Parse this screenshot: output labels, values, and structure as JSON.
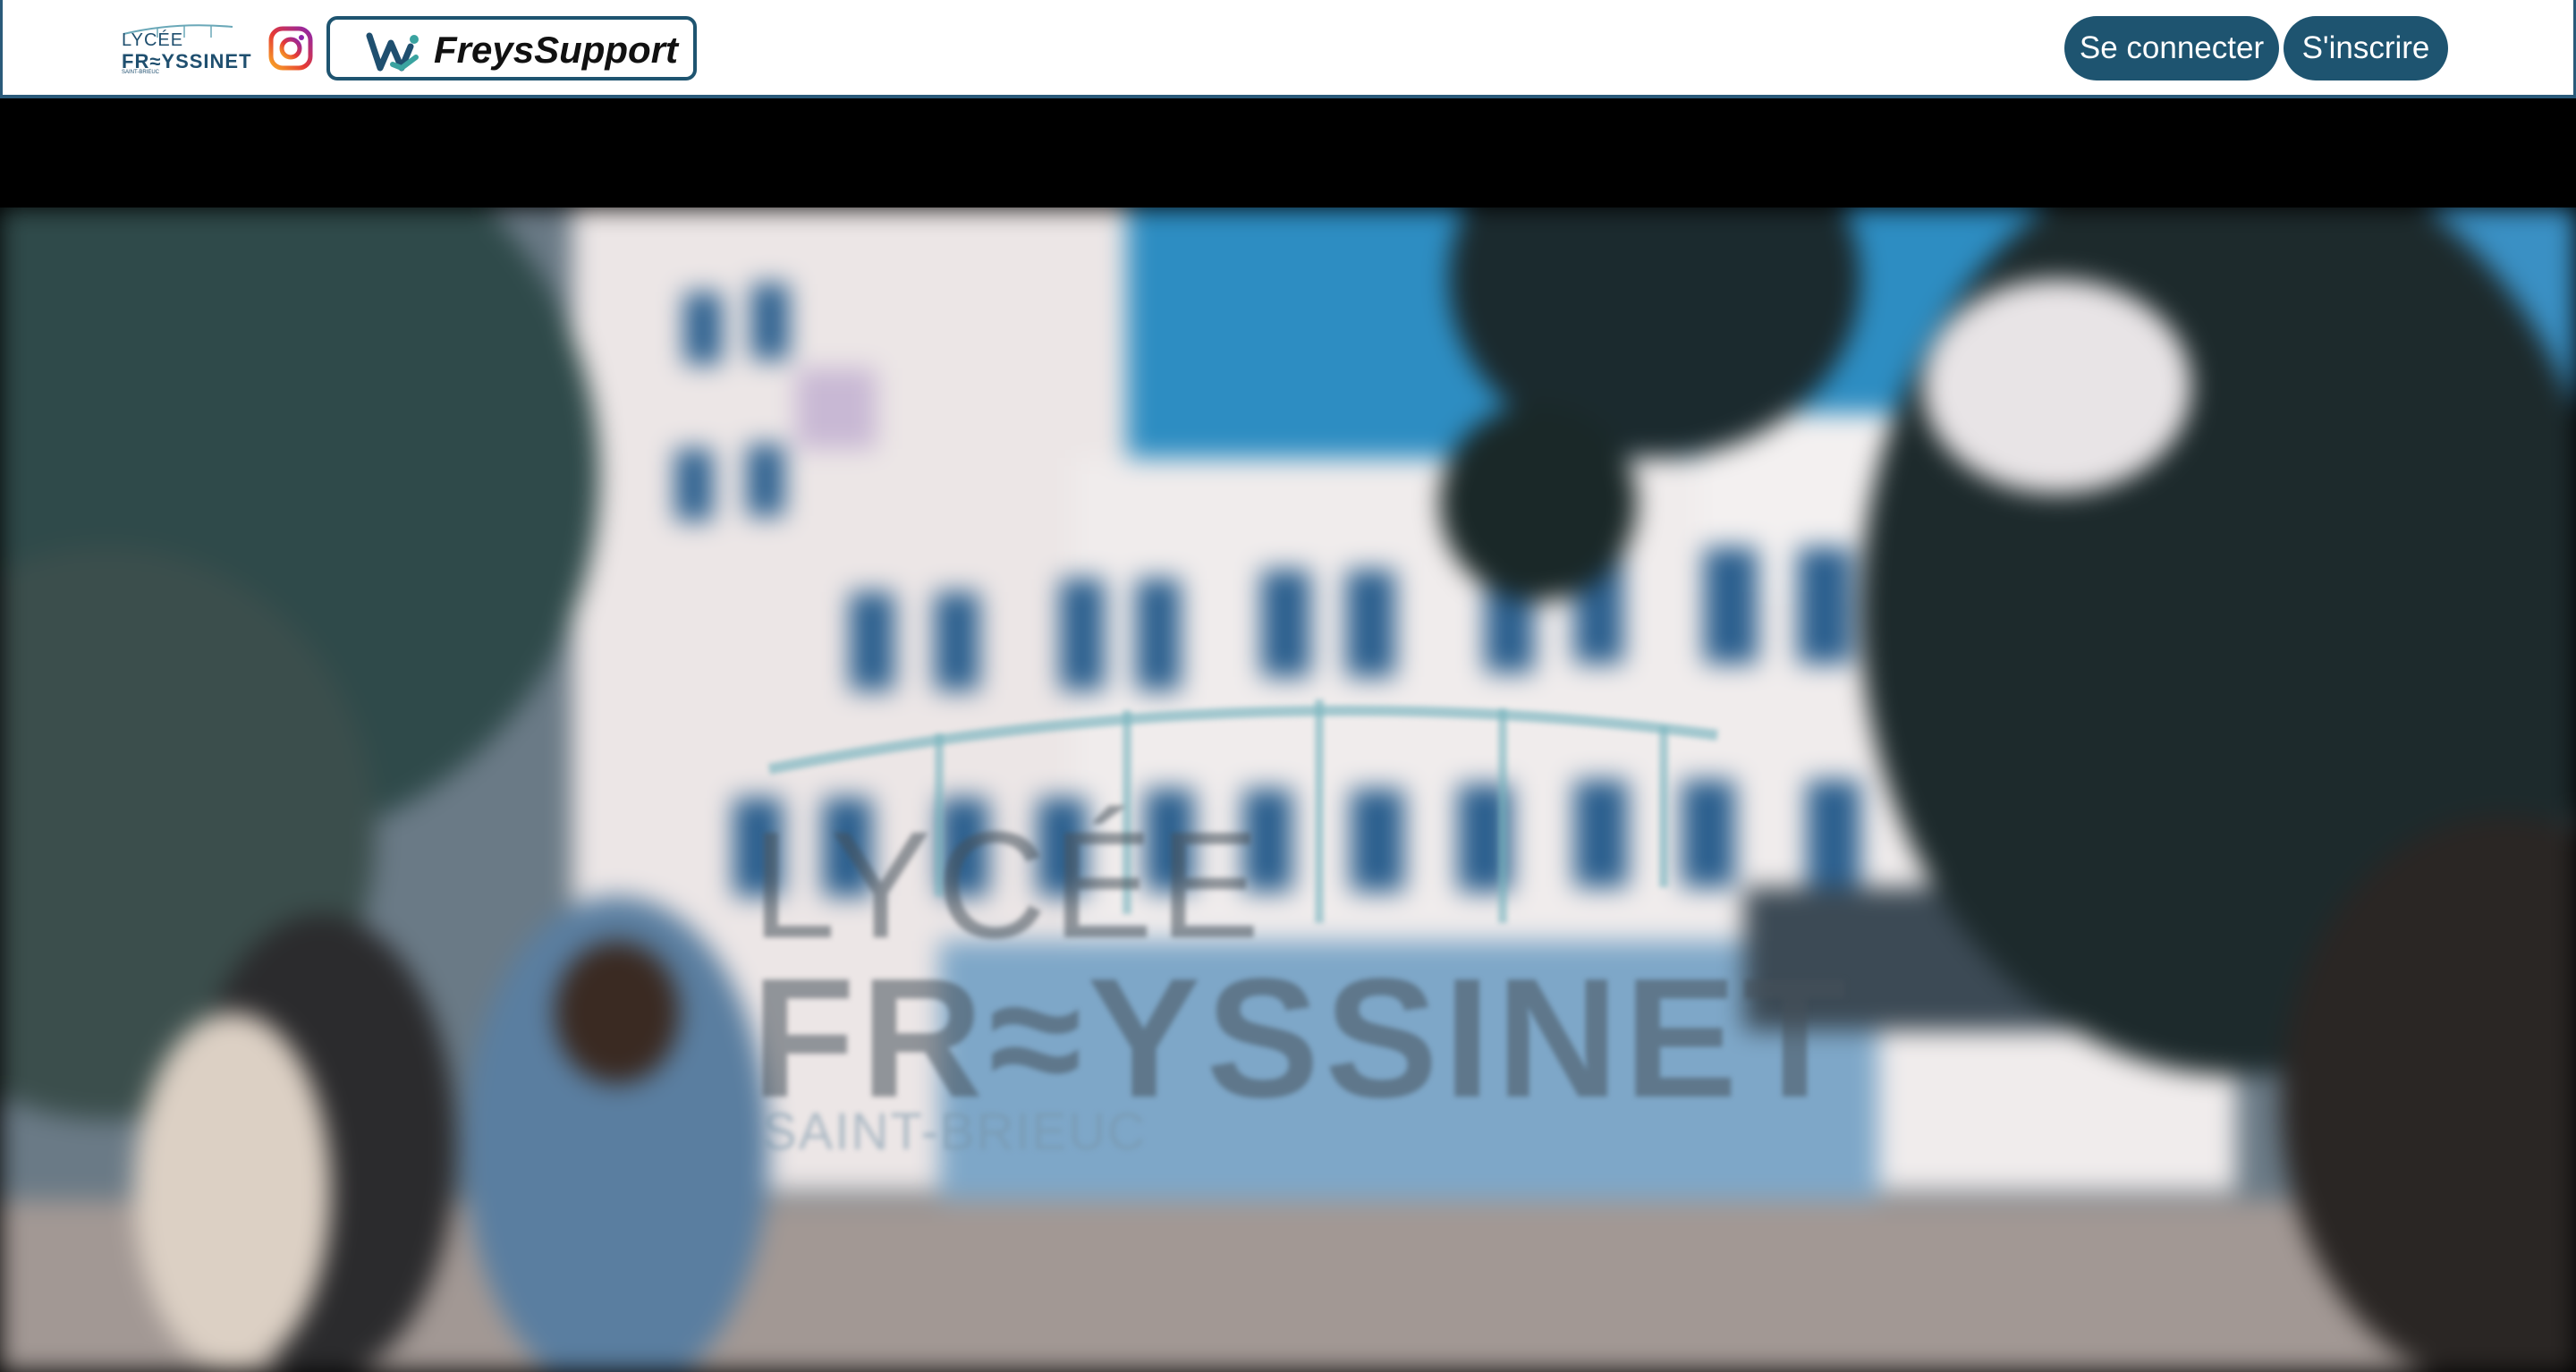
{
  "navbar": {
    "logo": {
      "line1": "LYCÉE",
      "line2": "FR≈YSSINET",
      "line3": "SAINT-BRIEUC"
    },
    "instagram_icon": "instagram-icon",
    "freyssupport_label": "FreysSupport",
    "freyssupport_icon": "freyssupport-logo-icon",
    "login_label": "Se connecter",
    "signup_label": "S'inscrire",
    "accent_color": "#1e5470"
  },
  "hero": {
    "background": "blurred photo of Lycée Freyssinet school building with students and trees",
    "logo_line1": "LYCÉE",
    "logo_line2": "FR≈YSSINET",
    "logo_line3": "SAINT-BRIEUC"
  }
}
